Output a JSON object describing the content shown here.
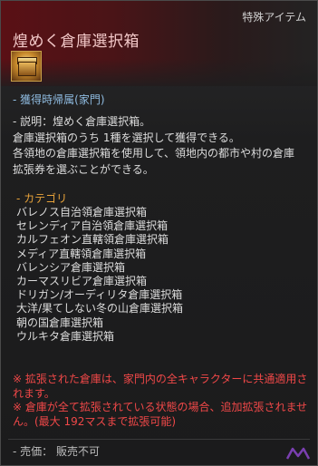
{
  "tooltip": {
    "grade": "特殊アイテム",
    "name": "煌めく倉庫選択箱",
    "icon": "treasure-chest-icon",
    "bind": "- 獲得時帰属(家門)",
    "description_lines": [
      "- 説明：煌めく倉庫選択箱。",
      "倉庫選択箱のうち 1種を選択して獲得できる。",
      "各領地の倉庫選択箱を使用して、領地内の都市や村の倉庫",
      "拡張券を選ぶことができる。"
    ],
    "category_heading": "- カテゴリ",
    "categories": [
      "バレノス自治領倉庫選択箱",
      "セレンディア自治領倉庫選択箱",
      "カルフェオン直轄領倉庫選択箱",
      "メディア直轄領倉庫選択箱",
      "バレンシア倉庫選択箱",
      "カーマスリビア倉庫選択箱",
      "ドリガン/オーディリタ倉庫選択箱",
      "大洋/果てしない冬の山倉庫選択箱",
      "朝の国倉庫選択箱",
      "ウルキタ倉庫選択箱"
    ],
    "warnings": [
      "※ 拡張された倉庫は、家門内の全キャラクターに共通適用されます。",
      "※ 倉庫が全て拡張されている状態の場合、追加拡張されません。(最大 192マスまで拡張可能)"
    ],
    "sale": "- 売価： 販売不可"
  },
  "colors": {
    "header_red": "#5a1015",
    "name": "#f2c8c8",
    "bind": "#8fbbe0",
    "category": "#e8a33a",
    "warning": "#f04848"
  }
}
